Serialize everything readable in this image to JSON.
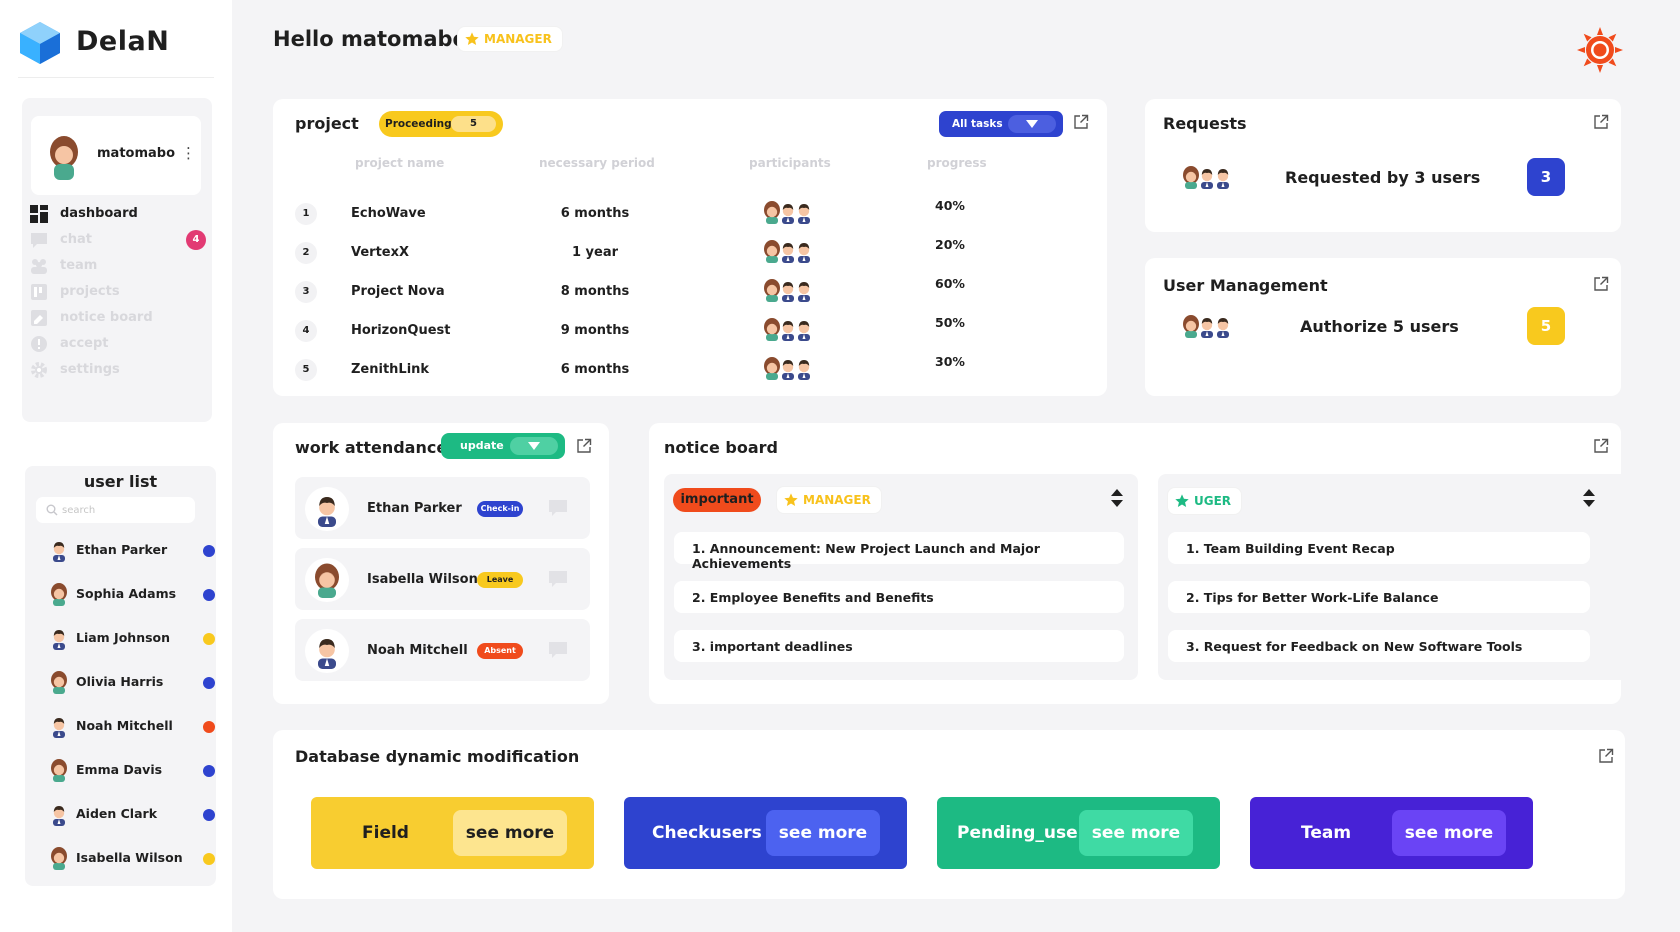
{
  "app": {
    "name": "DelaN"
  },
  "sidebar": {
    "profile": {
      "name": "matomabo"
    },
    "nav": [
      {
        "label": "dashboard",
        "icon": "dashboard-icon",
        "active": true
      },
      {
        "label": "chat",
        "icon": "chat-icon",
        "badge": "4"
      },
      {
        "label": "team",
        "icon": "team-icon"
      },
      {
        "label": "projects",
        "icon": "projects-icon"
      },
      {
        "label": "notice board",
        "icon": "notice-board-icon"
      },
      {
        "label": "accept",
        "icon": "accept-icon"
      },
      {
        "label": "settings",
        "icon": "settings-icon"
      }
    ],
    "userlist": {
      "title": "user list",
      "search_placeholder": "search",
      "users": [
        {
          "name": "Ethan Parker",
          "status_color": "#2e43cf",
          "avatar": "male"
        },
        {
          "name": "Sophia Adams",
          "status_color": "#2e43cf",
          "avatar": "female"
        },
        {
          "name": "Liam Johnson",
          "status_color": "#f8c91e",
          "avatar": "male"
        },
        {
          "name": "Olivia Harris",
          "status_color": "#2e43cf",
          "avatar": "female"
        },
        {
          "name": "Noah Mitchell",
          "status_color": "#f04b1c",
          "avatar": "male"
        },
        {
          "name": "Emma Davis",
          "status_color": "#2e43cf",
          "avatar": "female"
        },
        {
          "name": "Aiden Clark",
          "status_color": "#2e43cf",
          "avatar": "male"
        },
        {
          "name": "Isabella Wilson",
          "status_color": "#f8c91e",
          "avatar": "female"
        }
      ]
    }
  },
  "header": {
    "greeting": "Hello matomabo",
    "role": "MANAGER",
    "settings_icon": "sun-gear-icon"
  },
  "project": {
    "title": "project",
    "status_label": "Proceeding",
    "status_count": "5",
    "filter_label": "All tasks",
    "columns": [
      "project name",
      "necessary period",
      "participants",
      "progress"
    ],
    "rows": [
      {
        "num": "1",
        "name": "EchoWave",
        "period": "6 months",
        "progress": "40%"
      },
      {
        "num": "2",
        "name": "VertexX",
        "period": "1 year",
        "progress": "20%"
      },
      {
        "num": "3",
        "name": "Project Nova",
        "period": "8 months",
        "progress": "60%"
      },
      {
        "num": "4",
        "name": "HorizonQuest",
        "period": "9 months",
        "progress": "50%"
      },
      {
        "num": "5",
        "name": "ZenithLink",
        "period": "6 months",
        "progress": "30%"
      }
    ]
  },
  "requests": {
    "title": "Requests",
    "text": "Requested by 3 users",
    "count": "3",
    "count_color": "#2e43cf"
  },
  "user_management": {
    "title": "User Management",
    "text": "Authorize 5 users",
    "count": "5",
    "count_color": "#f8c91e"
  },
  "attendance": {
    "title": "work attendance",
    "update_label": "update",
    "rows": [
      {
        "name": "Ethan Parker",
        "status": "Check-in",
        "status_bg": "#2e43cf",
        "status_fg": "#ffffff",
        "avatar": "male"
      },
      {
        "name": "Isabella Wilson",
        "status": "Leave",
        "status_bg": "#f8c91e",
        "status_fg": "#1f1f1f",
        "avatar": "female"
      },
      {
        "name": "Noah Mitchell",
        "status": "Absent",
        "status_bg": "#f04b1c",
        "status_fg": "#ffffff",
        "avatar": "male"
      }
    ]
  },
  "notice_board": {
    "title": "notice board",
    "left": {
      "tag": "important",
      "role": "MANAGER",
      "items": [
        "1. Announcement: New Project Launch and Major Achievements",
        "2. Employee Benefits and Benefits",
        "3. important deadlines"
      ]
    },
    "right": {
      "role": "UGER",
      "items": [
        "1. Team Building Event Recap",
        "2. Tips for Better Work-Life Balance",
        "3. Request for Feedback on New Software Tools"
      ]
    }
  },
  "database": {
    "title": "Database dynamic modification",
    "blocks": [
      {
        "label": "Field",
        "button": "see more",
        "bg": "#f8cd30",
        "btn_bg": "#fde58f",
        "fg": "#1f1f1f"
      },
      {
        "label": "Checkusers",
        "button": "see more",
        "bg": "#2e43cf",
        "btn_bg": "#4c62f0",
        "fg": "#ffffff"
      },
      {
        "label": "Pending_users",
        "button": "see more",
        "bg": "#1dba83",
        "btn_bg": "#3fdaa4",
        "fg": "#ffffff"
      },
      {
        "label": "Team",
        "button": "see more",
        "bg": "#4722d6",
        "btn_bg": "#6a44f5",
        "fg": "#ffffff"
      }
    ]
  }
}
